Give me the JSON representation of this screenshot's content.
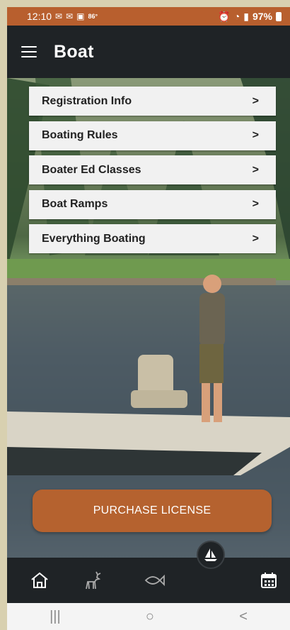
{
  "status_bar": {
    "time": "12:10",
    "temperature": "86°",
    "battery": "97%"
  },
  "header": {
    "title": "Boat"
  },
  "menu": {
    "items": [
      {
        "label": "Registration Info",
        "chevron": ">"
      },
      {
        "label": "Boating Rules",
        "chevron": ">"
      },
      {
        "label": "Boater Ed Classes",
        "chevron": ">"
      },
      {
        "label": "Boat Ramps",
        "chevron": ">"
      },
      {
        "label": "Everything Boating",
        "chevron": ">"
      }
    ]
  },
  "cta": {
    "label": "PURCHASE LICENSE"
  },
  "bottom_nav": {
    "items": [
      "home-icon",
      "deer-icon",
      "fish-icon",
      "sailboat-icon",
      "calendar-icon"
    ],
    "active": "sailboat-icon"
  },
  "system_nav": {
    "recents": "|||",
    "home": "○",
    "back": "<"
  },
  "colors": {
    "accent": "#b5622f",
    "header_bg": "#1f2326",
    "menu_bg": "#f1f1f1"
  }
}
